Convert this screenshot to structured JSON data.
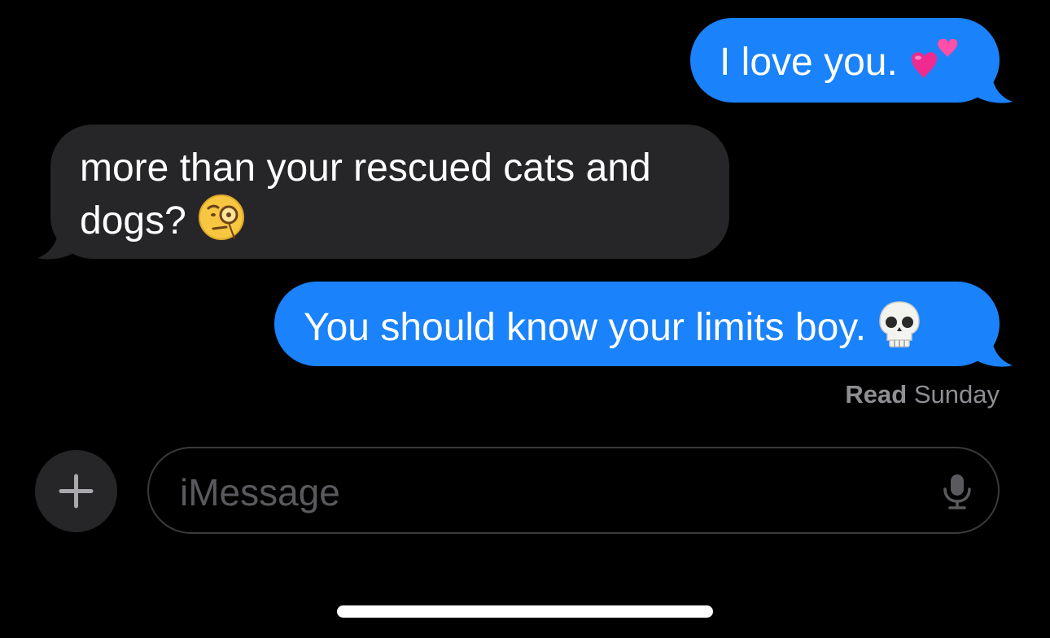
{
  "conversation": {
    "messages": [
      {
        "direction": "sent",
        "text": "I love you.",
        "emoji": "two-hearts"
      },
      {
        "direction": "received",
        "text": "more than your rescued cats and dogs?",
        "emoji": "face-with-monocle"
      },
      {
        "direction": "sent",
        "text": "You should know your limits boy.",
        "emoji": "skull"
      }
    ],
    "receipt": {
      "status": "Read",
      "when": "Sunday"
    }
  },
  "composer": {
    "placeholder": "iMessage",
    "add_icon": "plus-icon",
    "mic_icon": "microphone-icon"
  },
  "colors": {
    "background": "#000000",
    "sent_bubble": "#1a82fb",
    "received_bubble": "#262628",
    "receipt_text": "#8e8e93",
    "placeholder_text": "#5a5a5e"
  }
}
